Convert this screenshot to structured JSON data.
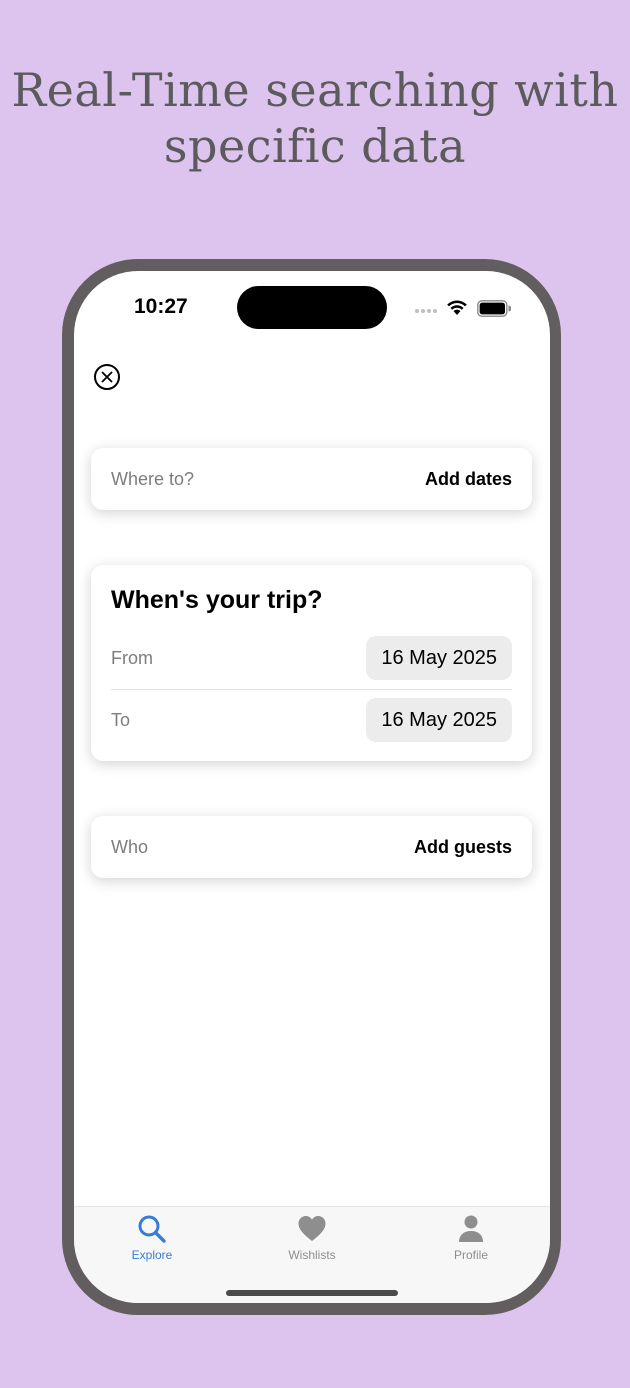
{
  "headline": {
    "line1": "Real-Time searching with",
    "line2": "specific data"
  },
  "status_bar": {
    "time": "10:27"
  },
  "search": {
    "where": {
      "label": "Where to?",
      "action": "Add dates"
    },
    "trip": {
      "title": "When's your trip?",
      "from_label": "From",
      "from_value": "16 May 2025",
      "to_label": "To",
      "to_value": "16 May 2025"
    },
    "who": {
      "label": "Who",
      "action": "Add guests"
    }
  },
  "tabs": [
    {
      "label": "Explore",
      "icon": "search-icon",
      "active": true
    },
    {
      "label": "Wishlists",
      "icon": "heart-icon",
      "active": false
    },
    {
      "label": "Profile",
      "icon": "person-icon",
      "active": false
    }
  ],
  "colors": {
    "background": "#dcc4ee",
    "frame": "#625e5f",
    "accent": "#3a7bd5",
    "inactive": "#8e8e8e"
  }
}
